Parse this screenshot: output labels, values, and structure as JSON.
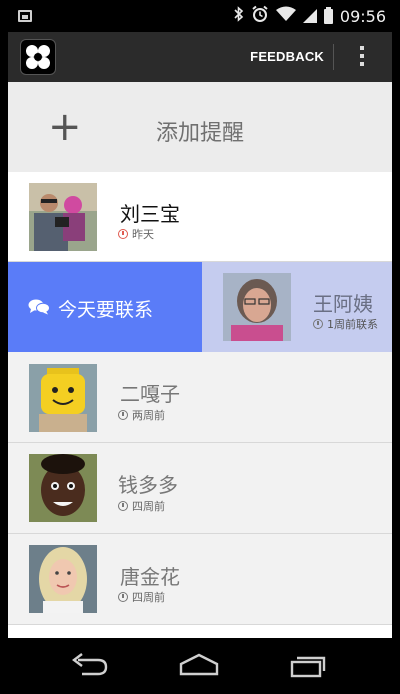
{
  "status_bar": {
    "time": "09:56",
    "icons": [
      "image-notification-icon",
      "bluetooth-icon",
      "alarm-icon",
      "wifi-icon",
      "signal-icon",
      "battery-icon"
    ]
  },
  "action_bar": {
    "logo_icon": "fan-logo-icon",
    "feedback_label": "FEEDBACK",
    "overflow_icon": "overflow-menu-icon"
  },
  "add_reminder": {
    "icon": "plus-icon",
    "label": "添加提醒"
  },
  "contacts": [
    {
      "name": "刘三宝",
      "meta": "昨天",
      "status_color": "#e05a4f"
    },
    {
      "name": "王阿姨",
      "meta": "1周前联系"
    },
    {
      "name": "二嘎子",
      "meta": "两周前"
    },
    {
      "name": "钱多多",
      "meta": "四周前"
    },
    {
      "name": "唐金花",
      "meta": "四周前"
    }
  ],
  "swipe_action": {
    "icon": "chat-bubbles-icon",
    "label": "今天要联系",
    "color": "#5a7cf8"
  },
  "nav_bar": {
    "icons": [
      "back-icon",
      "home-icon",
      "recent-apps-icon"
    ]
  },
  "colors": {
    "action_bar_bg": "#2b2b2b",
    "list_bg": "#f2f2f2",
    "swipe_bg": "#c5ccef"
  }
}
